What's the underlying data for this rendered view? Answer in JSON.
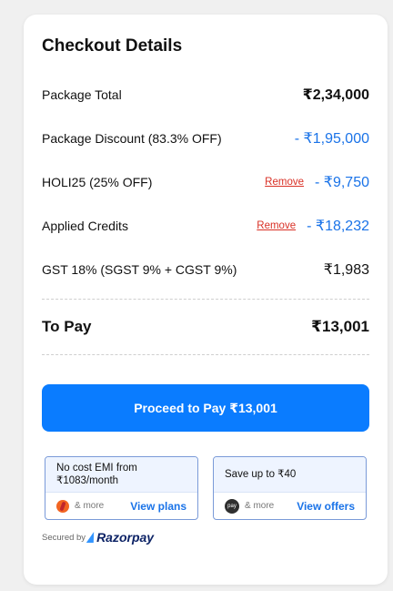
{
  "checkout": {
    "title": "Checkout Details",
    "rows": [
      {
        "label": "Package Total",
        "value": "₹2,34,000"
      },
      {
        "label": "Package Discount (83.3% OFF)",
        "value": "- ₹1,95,000"
      },
      {
        "label": "HOLI25 (25% OFF)",
        "value": "- ₹9,750",
        "action": "Remove"
      },
      {
        "label": "Applied Credits",
        "value": "- ₹18,232",
        "action": "Remove"
      },
      {
        "label": "GST 18% (SGST 9% + CGST 9%)",
        "value": "₹1,983"
      }
    ],
    "to_pay_label": "To Pay",
    "to_pay_value": "₹13,001",
    "pay_button": "Proceed to Pay ₹13,001"
  },
  "offers": [
    {
      "text": "No cost EMI from ₹1083/month",
      "more": "& more",
      "link": "View plans",
      "icon": "bank-logo-icon"
    },
    {
      "text": "Save up to ₹40",
      "more": "& more",
      "link": "View offers",
      "icon": "pay-logo-icon"
    }
  ],
  "footer": {
    "secured_by": "Secured by",
    "brand": "Razorpay"
  },
  "colors": {
    "accent": "#0a7cff",
    "discount": "#1a73e8",
    "remove": "#d93025"
  }
}
